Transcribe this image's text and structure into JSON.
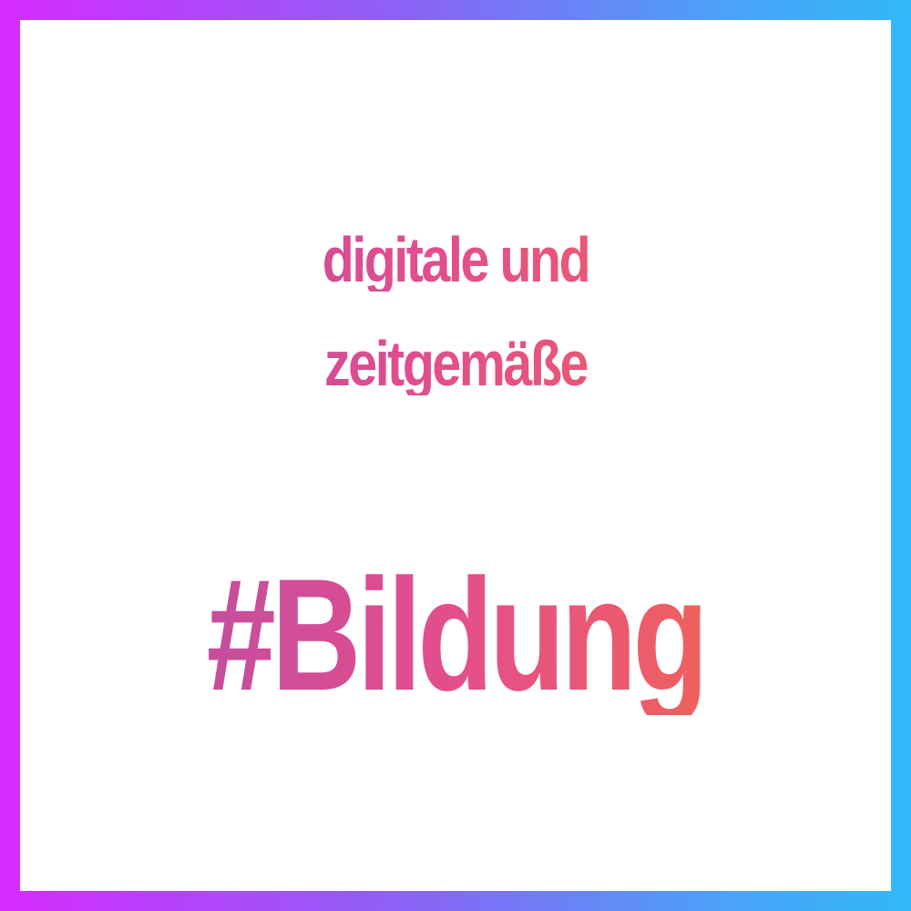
{
  "subtitle": {
    "line1": "digitale und",
    "line2": "zeitgemäße"
  },
  "headline": "#Bildung",
  "colors": {
    "frame_gradient": [
      "#d52bff",
      "#8a63f5",
      "#4aa3f8",
      "#31b8f8"
    ],
    "text_gradient": [
      "#b84ea3",
      "#e14d8f",
      "#ec5a6e",
      "#f06b48"
    ],
    "background": "#ffffff"
  }
}
